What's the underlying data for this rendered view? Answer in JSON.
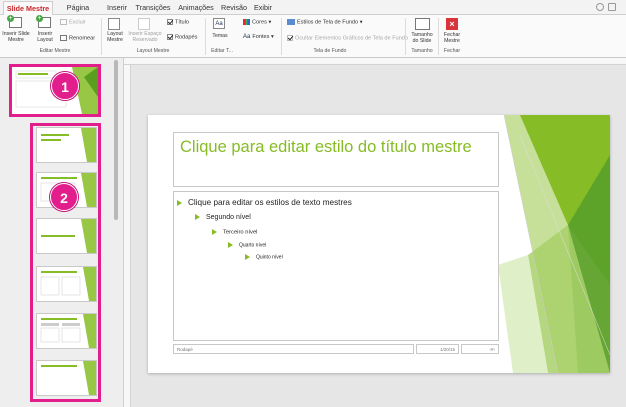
{
  "tabs": [
    "Slide Mestre",
    "Página Inicial",
    "Inserir",
    "Transições",
    "Animações",
    "Revisão",
    "Exibir"
  ],
  "ribbon": {
    "insert_slide_master": "Inserir Slide Mestre",
    "insert_layout": "Inserir Layout",
    "delete": "Excluir",
    "rename": "Renomear",
    "group_edit_master": "Editar Mestre",
    "master_layout": "Layout Mestre",
    "insert_placeholder": "Inserir Espaço Reservado",
    "title_check": "Título",
    "footers_check": "Rodapés",
    "group_master_layout": "Layout Mestre",
    "themes": "Temas",
    "group_edit_theme": "Editar T...",
    "colors": "Cores",
    "fonts": "Fontes",
    "bg_styles": "Estilos de Tela de Fundo",
    "hide_bg_graphics": "Ocultar Elementos Gráficos de Tela de Fundo",
    "group_background": "Tela de Fundo",
    "slide_size": "Tamanho do Slide",
    "group_size": "Tamanho",
    "close_master": "Fechar Mestre",
    "group_close": "Fechar"
  },
  "badges": [
    "1",
    "2"
  ],
  "slide": {
    "title": "Clique para editar estilo do título mestre",
    "levels": [
      "Clique para editar os estilos de texto mestres",
      "Segundo nível",
      "Terceiro nível",
      "Quarto nível",
      "Quinto nível"
    ],
    "footer_left": "Rodapé",
    "footer_date": "1/20/15",
    "footer_num": "‹#›"
  },
  "colors": {
    "accent": "#86bc25",
    "highlight": "#e21d8c",
    "tab_active": "#c8282b"
  }
}
